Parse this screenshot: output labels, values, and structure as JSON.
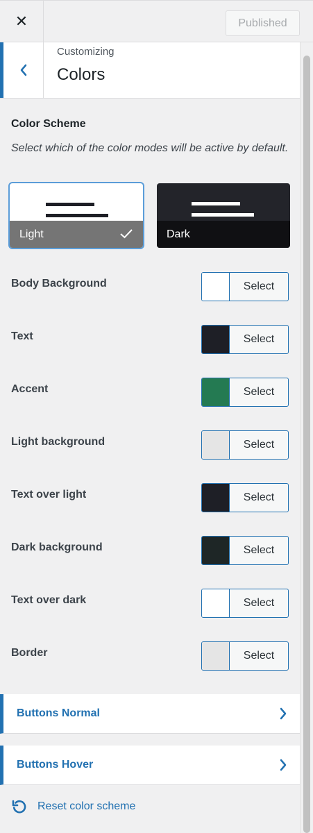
{
  "header": {
    "close_icon": "close-icon",
    "published_label": "Published"
  },
  "section": {
    "breadcrumb": "Customizing",
    "title": "Colors"
  },
  "color_scheme": {
    "title": "Color Scheme",
    "description": "Select which of the color modes will be active by default.",
    "options": [
      {
        "label": "Light",
        "selected": true
      },
      {
        "label": "Dark",
        "selected": false
      }
    ]
  },
  "picker_button_label": "Select",
  "colors": [
    {
      "label": "Body Background",
      "swatch": "#ffffff"
    },
    {
      "label": "Text",
      "swatch": "#1e1f26"
    },
    {
      "label": "Accent",
      "swatch": "#247a52"
    },
    {
      "label": "Light background",
      "swatch": "#e5e5e5"
    },
    {
      "label": "Text over light",
      "swatch": "#1e1f26"
    },
    {
      "label": "Dark background",
      "swatch": "#1e2626"
    },
    {
      "label": "Text over dark",
      "swatch": "#ffffff"
    },
    {
      "label": "Border",
      "swatch": "#e5e5e5"
    }
  ],
  "panels": [
    {
      "label": "Buttons Normal"
    },
    {
      "label": "Buttons Hover"
    }
  ],
  "reset_label": "Reset color scheme",
  "accent_color": "#2271b1"
}
